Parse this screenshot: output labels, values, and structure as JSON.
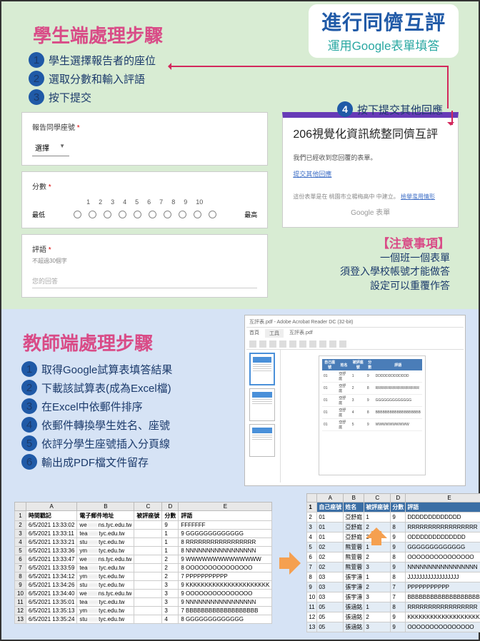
{
  "banner": {
    "main": "進行同儕互評",
    "sub": "運用Google表單填答"
  },
  "student": {
    "title": "學生端處理步驟",
    "steps": [
      "學生選擇報告者的座位",
      "選取分數和輸入評語",
      "按下提交"
    ],
    "step4": "按下提交其他回應"
  },
  "form": {
    "seatLabel": "報告同學座號",
    "selectText": "選擇",
    "scoreLabel": "分數",
    "nums": [
      "1",
      "2",
      "3",
      "4",
      "5",
      "6",
      "7",
      "8",
      "9",
      "10"
    ],
    "low": "最低",
    "high": "最高",
    "commentLabel": "評語",
    "commentHint": "不超過30個字",
    "commentPlaceholder": "您的回答"
  },
  "confirm": {
    "title": "206視覺化資訊統整同儕互評",
    "msg": "我們已經收到您回覆的表單。",
    "link": "提交其他回應",
    "footer1": "這份表單是在 桃園市立楊梅高中 中建立。",
    "footer2": "檢舉濫用情形",
    "google": "Google 表單"
  },
  "notice": {
    "title": "【注意事項】",
    "lines": [
      "一個班一個表單",
      "須登入學校帳號才能做答",
      "設定可以重覆作答"
    ]
  },
  "teacher": {
    "title": "教師端處理步驟",
    "steps": [
      "取得Google試算表填答結果",
      "下載該試算表(成為Excel檔)",
      "在Excel中依郵件排序",
      "依郵件轉換學生姓名、座號",
      "依評分學生座號插入分頁線",
      "輸出成PDF檔文件留存"
    ]
  },
  "adobe": {
    "title": "互評表.pdf - Adobe Acrobat Reader DC (32-bit)",
    "tabs": [
      "首頁",
      "工具",
      "互評表.pdf"
    ]
  },
  "docHeaders": [
    "自己座號",
    "姓名",
    "被評座號",
    "分數",
    "評語"
  ],
  "docRows": [
    [
      "01",
      "亞舒庭",
      "1",
      "9",
      "DDDDDDDDDDDDD"
    ],
    [
      "01",
      "亞舒庭",
      "2",
      "8",
      "RRRRRRRRRRRRRRRRR"
    ],
    [
      "01",
      "亞舒庭",
      "3",
      "9",
      "GGGGGGGGGGGGG"
    ],
    [
      "01",
      "亞舒庭",
      "4",
      "8",
      "BBBBBBBBBBBBBBBBBBB"
    ],
    [
      "01",
      "亞舒庭",
      "5",
      "9",
      "WWWWWWWWWW"
    ]
  ],
  "excel": {
    "cols": [
      "",
      "A",
      "B",
      "C",
      "D",
      "E"
    ],
    "headers": [
      "時間戳記",
      "電子郵件地址",
      "被評座號",
      "分數",
      "評語"
    ],
    "rows": [
      [
        "6/5/2021 13:33:02",
        "we          ns.tyc.edu.tw",
        "",
        "9",
        "FFFFFFF"
      ],
      [
        "6/5/2021 13:33:11",
        "tea          tyc.edu.tw",
        "",
        "1",
        "9 GGGGGGGGGGGGG"
      ],
      [
        "6/5/2021 13:33:21",
        "stu            tyc.edu.tw",
        "",
        "1",
        "8 RRRRRRRRRRRRRRRRR"
      ],
      [
        "6/5/2021 13:33:36",
        "ym           tyc.edu.tw",
        "",
        "1",
        "8 NNNNNNNNNNNNNNNNN"
      ],
      [
        "6/5/2021 13:33:47",
        "we           ns.tyc.edu.tw",
        "",
        "2",
        "9 WWWWWWWWWWWWWW"
      ],
      [
        "6/5/2021 13:33:59",
        "tea           tyc.edu.tw",
        "",
        "2",
        "8 OOOOOOOOOOOOOOO"
      ],
      [
        "6/5/2021 13:34:12",
        "ym           tyc.edu.tw",
        "",
        "2",
        "7 PPPPPPPPPPP"
      ],
      [
        "6/5/2021 13:34:26",
        "stu            tyc.edu.tw",
        "",
        "3",
        "9 KKKKKKKKKKKKKKKKKKKKKK"
      ],
      [
        "6/5/2021 13:34:40",
        "we           ns.tyc.edu.tw",
        "",
        "3",
        "9 OOOOOOOOOOOOOOO"
      ],
      [
        "6/5/2021 13:35:01",
        "tea           tyc.edu.tw",
        "",
        "3",
        "9 NNNNNNNNNNNNNNNNN"
      ],
      [
        "6/5/2021 13:35:13",
        "ym           tyc.edu.tw",
        "",
        "3",
        "7 BBBBBBBBBBBBBBBBBBB"
      ],
      [
        "6/5/2021 13:35:24",
        "stu            tyc.edu.tw",
        "",
        "4",
        "8 GGGGGGGGGGGGG"
      ]
    ]
  },
  "result": {
    "cols": [
      "",
      "A",
      "B",
      "C",
      "D",
      "E"
    ],
    "headers": [
      "自己座號",
      "姓名",
      "被評座號",
      "分數",
      "評語"
    ],
    "rows": [
      [
        "01",
        "亞舒庭",
        "1",
        "9",
        "DDDDDDDDDDDDD"
      ],
      [
        "01",
        "亞舒庭",
        "2",
        "8",
        "RRRRRRRRRRRRRRRRR"
      ],
      [
        "01",
        "亞舒庭",
        "3",
        "9",
        "ODDDDDDDDDDDDD"
      ],
      [
        "02",
        "熊萱蓉",
        "1",
        "9",
        "GGGGGGGGGGGGG"
      ],
      [
        "02",
        "熊萱蓉",
        "2",
        "8",
        "OOOOOOOOOOOOOOO"
      ],
      [
        "02",
        "熊萱蓉",
        "3",
        "9",
        "NNNNNNNNNNNNNNNNN"
      ],
      [
        "03",
        "張宇濤",
        "1",
        "8",
        "JJJJJJJJJJJJJJJJJJ"
      ],
      [
        "03",
        "張宇濤",
        "2",
        "7",
        "PPPPPPPPPPP"
      ],
      [
        "03",
        "張宇濤",
        "3",
        "7",
        "BBBBBBBBBBBBBBBBBBB"
      ],
      [
        "05",
        "張涵銘",
        "1",
        "8",
        "RRRRRRRRRRRRRRRRR"
      ],
      [
        "05",
        "張涵銘",
        "2",
        "9",
        "KKKKKKKKKKKKKKKKKKKKKK"
      ],
      [
        "05",
        "張涵銘",
        "3",
        "9",
        "OOOOOOOOOOOOOOO"
      ]
    ]
  }
}
